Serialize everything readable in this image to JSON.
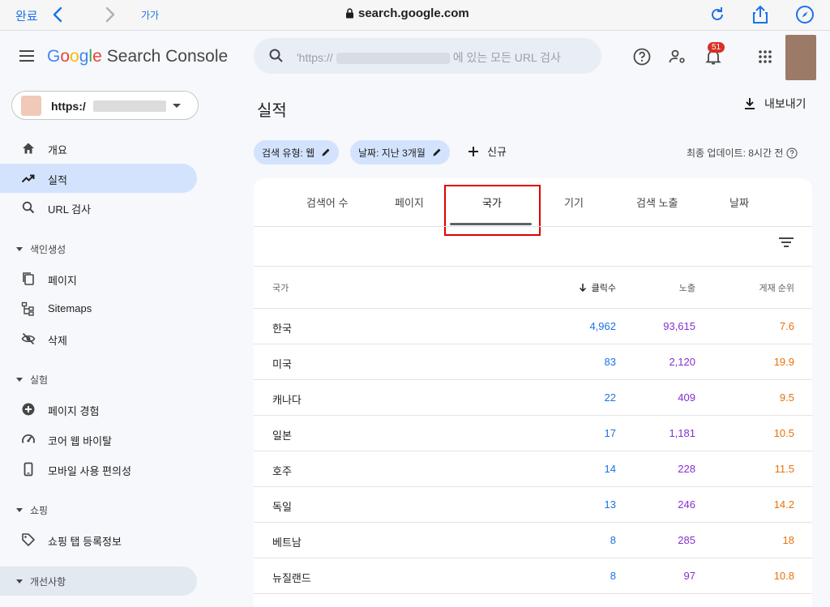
{
  "safari": {
    "done": "완료",
    "aa": "가가",
    "address": "search.google.com"
  },
  "header": {
    "logo_google": [
      "G",
      "o",
      "o",
      "g",
      "l",
      "e"
    ],
    "logo_product": "Search Console",
    "search_prefix": "'https://",
    "search_suffix": "에 있는 모든 URL 검사",
    "notification_count": "51"
  },
  "sidebar": {
    "property": "https:/",
    "items": [
      {
        "label": "개요",
        "icon": "home-icon"
      },
      {
        "label": "실적",
        "icon": "trending-up-icon",
        "active": true
      },
      {
        "label": "URL 검사",
        "icon": "search-icon"
      }
    ],
    "sections": [
      {
        "label": "색인생성",
        "items": [
          {
            "label": "페이지",
            "icon": "pages-icon"
          },
          {
            "label": "Sitemaps",
            "icon": "sitemap-icon"
          },
          {
            "label": "삭제",
            "icon": "removal-icon"
          }
        ]
      },
      {
        "label": "실험",
        "items": [
          {
            "label": "페이지 경험",
            "icon": "page-experience-icon"
          },
          {
            "label": "코어 웹 바이탈",
            "icon": "speedometer-icon"
          },
          {
            "label": "모바일 사용 편의성",
            "icon": "phone-icon"
          }
        ]
      },
      {
        "label": "쇼핑",
        "items": [
          {
            "label": "쇼핑 탭 등록정보",
            "icon": "tag-icon"
          }
        ]
      },
      {
        "label": "개선사항",
        "items": []
      }
    ]
  },
  "main": {
    "title": "실적",
    "export": "내보내기",
    "chips": [
      "검색 유형: 웹",
      "날짜: 지난 3개월"
    ],
    "add_new": "신규",
    "updated": "최종 업데이트: 8시간 전",
    "tabs": [
      "검색어 수",
      "페이지",
      "국가",
      "기기",
      "검색 노출",
      "날짜"
    ],
    "active_tab": "국가",
    "columns": [
      "국가",
      "클릭수",
      "노출",
      "게재 순위"
    ],
    "rows": [
      [
        "한국",
        "4,962",
        "93,615",
        "7.6"
      ],
      [
        "미국",
        "83",
        "2,120",
        "19.9"
      ],
      [
        "캐나다",
        "22",
        "409",
        "9.5"
      ],
      [
        "일본",
        "17",
        "1,181",
        "10.5"
      ],
      [
        "호주",
        "14",
        "228",
        "11.5"
      ],
      [
        "독일",
        "13",
        "246",
        "14.2"
      ],
      [
        "베트남",
        "8",
        "285",
        "18"
      ],
      [
        "뉴질랜드",
        "8",
        "97",
        "10.8"
      ]
    ]
  }
}
